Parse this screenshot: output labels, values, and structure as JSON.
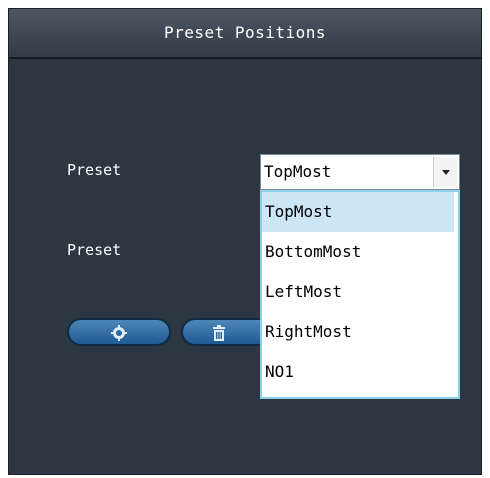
{
  "header": {
    "title": "Preset Positions"
  },
  "form": {
    "preset_label_1": "Preset",
    "preset_label_2": "Preset",
    "select_value": "TopMost"
  },
  "dropdown": {
    "options": [
      "TopMost",
      "BottomMost",
      "LeftMost",
      "RightMost",
      "NO1"
    ],
    "selected_index": 0
  },
  "buttons": {
    "settings_icon": "gear-icon",
    "delete_icon": "trash-icon"
  },
  "colors": {
    "panel_bg": "#2c3742",
    "accent_border": "#8ad2ec",
    "selected_option": "#cde6f7",
    "button_blue": "#1f5a94"
  }
}
